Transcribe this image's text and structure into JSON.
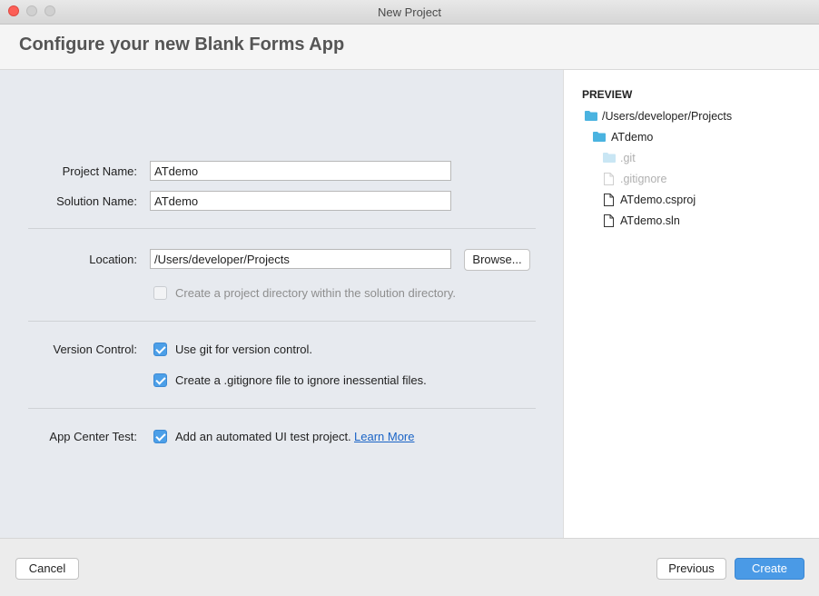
{
  "window": {
    "title": "New Project"
  },
  "header": {
    "title": "Configure your new Blank Forms App"
  },
  "form": {
    "project_name_label": "Project Name:",
    "project_name_value": "ATdemo",
    "solution_name_label": "Solution Name:",
    "solution_name_value": "ATdemo",
    "location_label": "Location:",
    "location_value": "/Users/developer/Projects",
    "browse_label": "Browse...",
    "create_dir_label": "Create a project directory within the solution directory.",
    "create_dir_checked": false,
    "version_control_label": "Version Control:",
    "use_git_label": "Use git for version control.",
    "use_git_checked": true,
    "gitignore_label": "Create a .gitignore file to ignore inessential files.",
    "gitignore_checked": true,
    "app_center_label": "App Center Test:",
    "ui_test_label": "Add an automated UI test project.",
    "ui_test_checked": true,
    "learn_more_label": "Learn More"
  },
  "preview": {
    "heading": "PREVIEW",
    "items": [
      {
        "name": "/Users/developer/Projects",
        "kind": "folder",
        "dim": false
      },
      {
        "name": "ATdemo",
        "kind": "folder",
        "dim": false
      },
      {
        "name": ".git",
        "kind": "folder",
        "dim": true
      },
      {
        "name": ".gitignore",
        "kind": "file",
        "dim": true
      },
      {
        "name": "ATdemo.csproj",
        "kind": "file",
        "dim": false
      },
      {
        "name": "ATdemo.sln",
        "kind": "file",
        "dim": false
      }
    ]
  },
  "footer": {
    "cancel_label": "Cancel",
    "previous_label": "Previous",
    "create_label": "Create"
  },
  "colors": {
    "accent": "#4a9ae6",
    "folder": "#4ab3e0",
    "folder_dim": "#c9e6f4",
    "link": "#1a64c6",
    "close": "#fc5f57"
  }
}
